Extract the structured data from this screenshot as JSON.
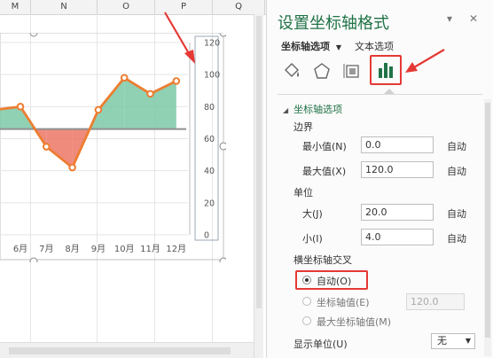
{
  "sheet": {
    "columns": [
      "M",
      "N",
      "O",
      "P",
      "Q"
    ]
  },
  "chart_data": {
    "type": "line",
    "x": [
      "6月",
      "7月",
      "8月",
      "9月",
      "10月",
      "11月",
      "12月"
    ],
    "series": [
      {
        "values": [
          80,
          55,
          42,
          78,
          98,
          88,
          96
        ],
        "color": "#ED7D31"
      }
    ],
    "partial_visible_left": [
      {
        "x": "",
        "value": 40
      },
      {
        "x": "",
        "value": 78
      }
    ],
    "reference": 66,
    "ylim": [
      0,
      120
    ],
    "yticks": [
      "0",
      "20",
      "40",
      "60",
      "80",
      "100",
      "120"
    ],
    "fill_above_color": "#7DC8A6",
    "fill_below_color": "#EB7766",
    "grid": true
  },
  "panel": {
    "title": "设置坐标轴格式",
    "tab_axis_options": "坐标轴选项",
    "tab_text_options": "文本选项",
    "section": "坐标轴选项",
    "bounds_label": "边界",
    "min_label": "最小值(N)",
    "min_value": "0.0",
    "max_label": "最大值(X)",
    "max_value": "120.0",
    "auto_label": "自动",
    "units_label": "单位",
    "major_label": "大(J)",
    "major_value": "20.0",
    "minor_label": "小(I)",
    "minor_value": "4.0",
    "cross_label": "横坐标轴交叉",
    "radio_auto": "自动(O)",
    "radio_axis_value": "坐标轴值(E)",
    "axis_value_placeholder": "120.0",
    "radio_max": "最大坐标轴值(M)",
    "display_units_label": "显示单位(U)",
    "display_units_value": "无"
  }
}
